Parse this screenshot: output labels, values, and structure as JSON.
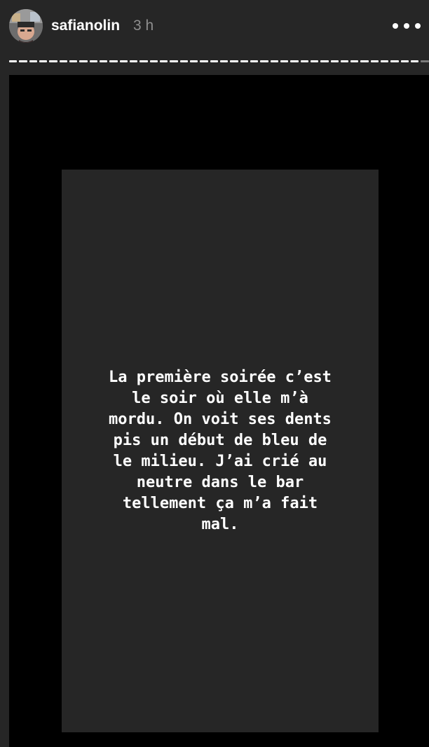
{
  "header": {
    "username": "safianolin",
    "time": "3 h",
    "avatar_icon": "profile-photo",
    "more_icon": "more-horizontal-icon"
  },
  "progress": {
    "segments_seen": 41,
    "segments_total": 42
  },
  "story": {
    "text_lines": [
      "La première soirée c’est",
      "le soir où elle m’à",
      "mordu. On voit ses dents",
      "pis un début de bleu de",
      "le milieu. J’ai crié au",
      "neutre dans le bar",
      "tellement ça m’a fait",
      "mal."
    ]
  },
  "colors": {
    "background": "#262626",
    "viewer": "#000000",
    "progress_seen": "#ffffff",
    "progress_unseen": "#7b7b7b",
    "text": "#ffffff",
    "time": "#8e8e8e"
  }
}
